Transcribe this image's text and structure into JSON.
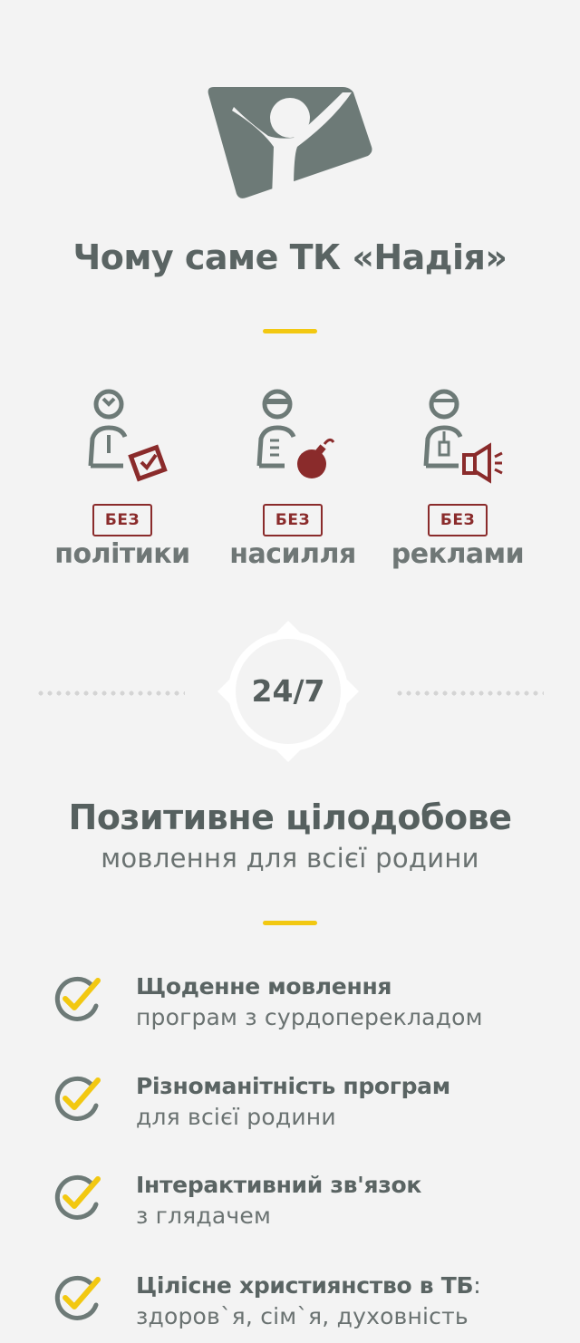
{
  "logo": {
    "name": "tk-nadiya-logo",
    "color": "#6d7a77"
  },
  "title": "Чому саме ТК «Надія»",
  "features": [
    {
      "icon": "person-with-ballot-icon",
      "badge": "БЕЗ",
      "label": "політики"
    },
    {
      "icon": "masked-person-with-bomb-icon",
      "badge": "БЕЗ",
      "label": "насилля"
    },
    {
      "icon": "person-with-megaphone-icon",
      "badge": "БЕЗ",
      "label": "реклами"
    }
  ],
  "schedule": {
    "label": "24/7"
  },
  "headline": "Позитивне цілодобове",
  "subheadline": "мовлення для всієї родини",
  "benefits": [
    {
      "icon": "check-circle-icon",
      "title": "Щоденне мовлення",
      "subtitle": "програм з сурдоперекладом"
    },
    {
      "icon": "check-circle-icon",
      "title": "Різноманітність програм",
      "subtitle": "для всієї родини"
    },
    {
      "icon": "check-circle-icon",
      "title": "Інтерактивний зв'язок",
      "subtitle": "з глядачем"
    },
    {
      "icon": "check-circle-icon",
      "title": "Цілісне християнство в ТБ",
      "title_suffix": ":",
      "subtitle": "здоров`я, сім`я, духовність"
    }
  ],
  "colors": {
    "background": "#f3f3f3",
    "text": "#56605f",
    "accent": "#f2c811",
    "badge": "#8a2b2b"
  }
}
